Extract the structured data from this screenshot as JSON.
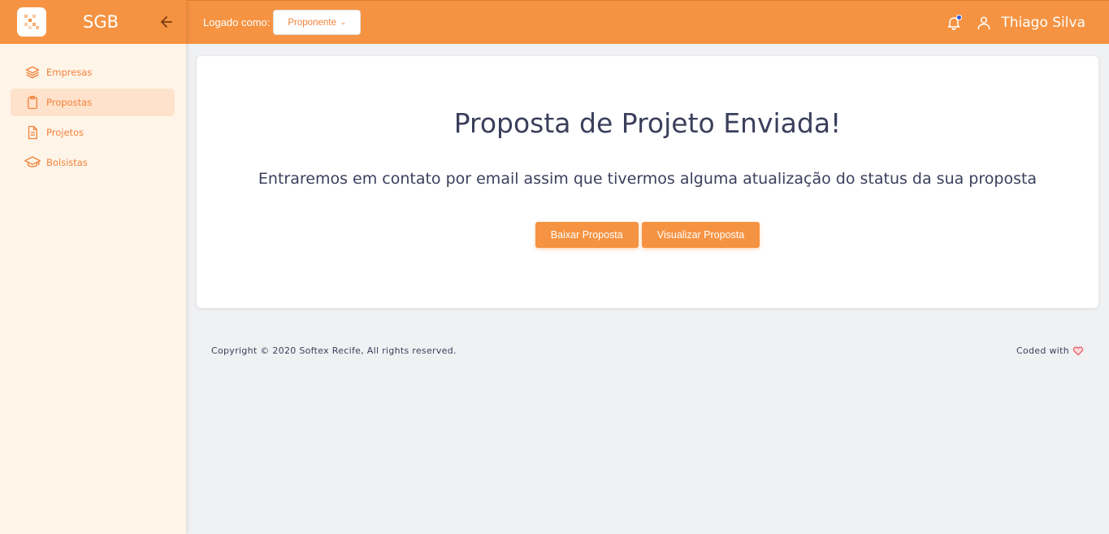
{
  "brand": {
    "name": "SGB",
    "logo_icon": "logo-icon",
    "collapse_icon": "arrow-left-icon"
  },
  "sidebar": {
    "items": [
      {
        "label": "Empresas",
        "icon": "layers-icon",
        "active": false
      },
      {
        "label": "Propostas",
        "icon": "clipboard-icon",
        "active": true
      },
      {
        "label": "Projetos",
        "icon": "document-icon",
        "active": false
      },
      {
        "label": "Bolsistas",
        "icon": "graduation-cap-icon",
        "active": false
      }
    ]
  },
  "header": {
    "logged_as_label": "Logado como:",
    "role_selected": "Proponente",
    "user_name": "Thiago Silva",
    "notification_dot": true
  },
  "main": {
    "title": "Proposta de Projeto Enviada!",
    "message": "Entraremos em contato por email assim que tivermos alguma atualização do status da sua proposta",
    "buttons": {
      "download": "Baixar Proposta",
      "view": "Visualizar Proposta"
    }
  },
  "footer": {
    "copyright": "Copyright © 2020 Softex Recife, All rights reserved.",
    "coded_with": "Coded with"
  },
  "colors": {
    "accent": "#f59342",
    "sidebar_bg": "#fff4e8",
    "active_bg": "#ffe2cc",
    "text_dark": "#3b3f5c",
    "notification": "#2c54d9",
    "heart": "#e7515a"
  }
}
